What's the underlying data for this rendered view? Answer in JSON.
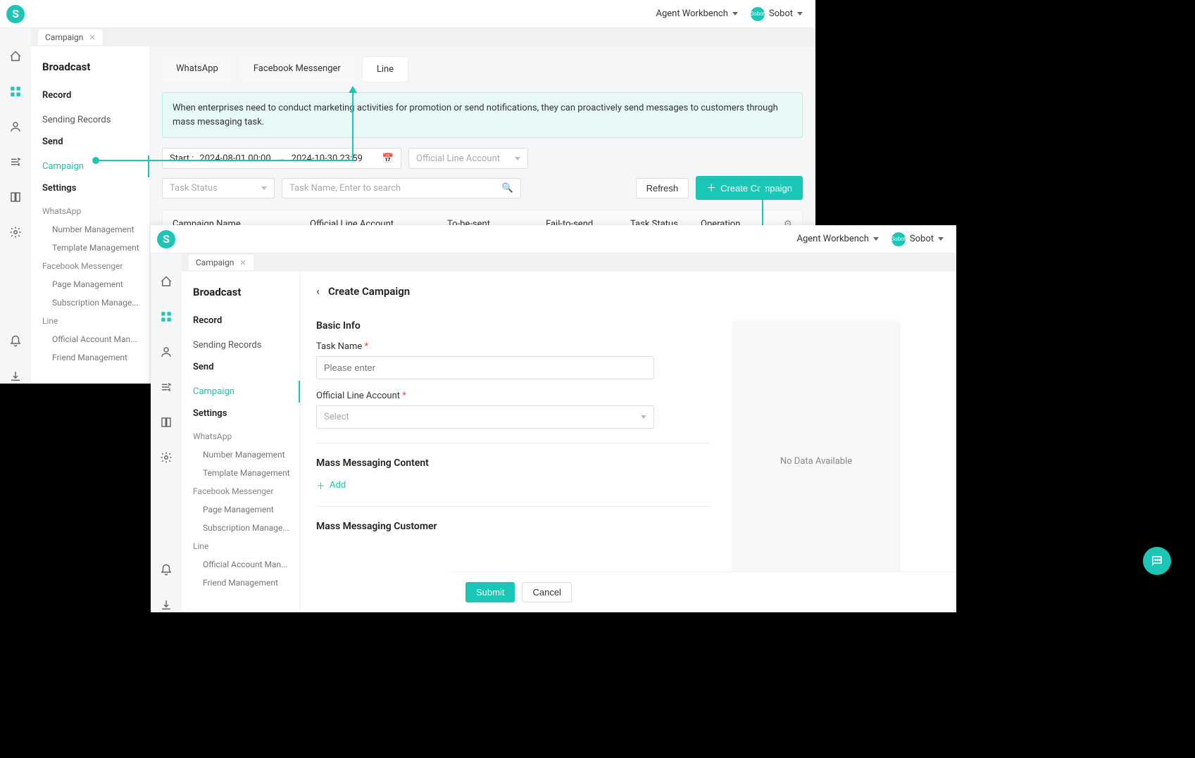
{
  "header": {
    "workbench": "Agent Workbench",
    "user": "Sobot",
    "avatar_text": "Sobot"
  },
  "tab": {
    "label": "Campaign"
  },
  "sidebar": {
    "title": "Broadcast",
    "record_section": "Record",
    "sending_records": "Sending Records",
    "send_section": "Send",
    "campaign": "Campaign",
    "settings_section": "Settings",
    "whatsapp_group": "WhatsApp",
    "wa_number": "Number Management",
    "wa_template": "Template Management",
    "fb_group": "Facebook Messenger",
    "fb_page": "Page Management",
    "fb_sub": "Subscription Manage...",
    "line_group": "Line",
    "line_official": "Official Account Man...",
    "line_friend": "Friend Management"
  },
  "main": {
    "tab_whatsapp": "WhatsApp",
    "tab_fb": "Facebook Messenger",
    "tab_line": "Line",
    "banner": "When enterprises need to conduct marketing activities for promotion or send notifications, they can proactively send messages to customers through mass messaging task.",
    "start_label": "Start :",
    "start_from": "2024-08-01 00:00",
    "start_to": "2024-10-30 23:59",
    "account_ph": "Official Line Account",
    "status_ph": "Task Status",
    "search_ph": "Task Name, Enter to search",
    "refresh": "Refresh",
    "create": "Create Campaign",
    "columns": {
      "name": "Campaign Name",
      "account": "Official Line Account",
      "tobesent": "To-be-sent",
      "fail": "Fail-to-send",
      "status": "Task Status",
      "op": "Operation"
    }
  },
  "layer2": {
    "crumb": "Create Campaign",
    "basic_info": "Basic Info",
    "task_name_label": "Task Name",
    "task_name_ph": "Please enter",
    "account_label": "Official Line Account",
    "account_ph": "Select",
    "mass_content": "Mass Messaging Content",
    "add": "Add",
    "mass_customer": "Mass Messaging Customer",
    "submit": "Submit",
    "cancel": "Cancel",
    "preview_empty": "No Data Available",
    "sidebar2": {
      "fb_sub": "Subscription Manage...",
      "line_official": "Official Account Man..."
    }
  }
}
